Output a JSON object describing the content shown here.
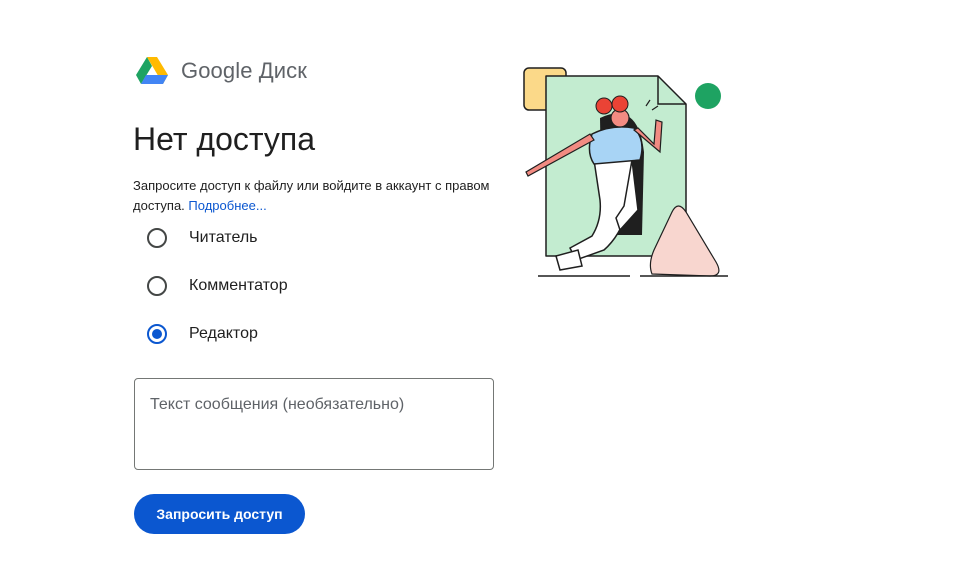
{
  "brand": {
    "name": "Google Диск"
  },
  "title": "Нет доступа",
  "description": {
    "text": "Запросите доступ к файлу или войдите в аккаунт с правом доступа.",
    "link": "Подробнее..."
  },
  "roles": [
    {
      "label": "Читатель",
      "selected": false
    },
    {
      "label": "Комментатор",
      "selected": false
    },
    {
      "label": "Редактор",
      "selected": true
    }
  ],
  "message": {
    "placeholder": "Текст сообщения (необязательно)",
    "value": ""
  },
  "request_button": {
    "label": "Запросить доступ"
  },
  "colors": {
    "accent": "#0b57d0",
    "drive_green": "#1ea362",
    "drive_yellow": "#ffba00",
    "drive_blue": "#4285f4"
  }
}
